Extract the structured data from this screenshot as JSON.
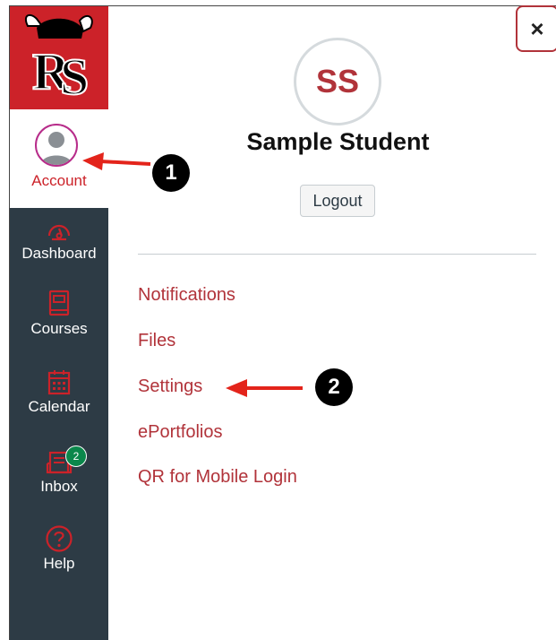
{
  "sidebar": {
    "account_label": "Account",
    "items": [
      {
        "label": "Dashboard",
        "icon": "speedometer-icon"
      },
      {
        "label": "Courses",
        "icon": "book-icon"
      },
      {
        "label": "Calendar",
        "icon": "calendar-icon"
      },
      {
        "label": "Inbox",
        "icon": "inbox-icon",
        "badge": "2"
      },
      {
        "label": "Help",
        "icon": "help-icon"
      }
    ]
  },
  "tray": {
    "close_label": "×",
    "avatar_initials": "SS",
    "user_name": "Sample Student",
    "logout_label": "Logout",
    "links": [
      "Notifications",
      "Files",
      "Settings",
      "ePortfolios",
      "QR for Mobile Login"
    ]
  },
  "annotations": {
    "marker_1": "1",
    "marker_2": "2"
  },
  "colors": {
    "brand_red": "#cc2229",
    "link_red": "#b1333a",
    "sidebar_bg": "#2d3b45",
    "badge_green": "#0b874b"
  }
}
